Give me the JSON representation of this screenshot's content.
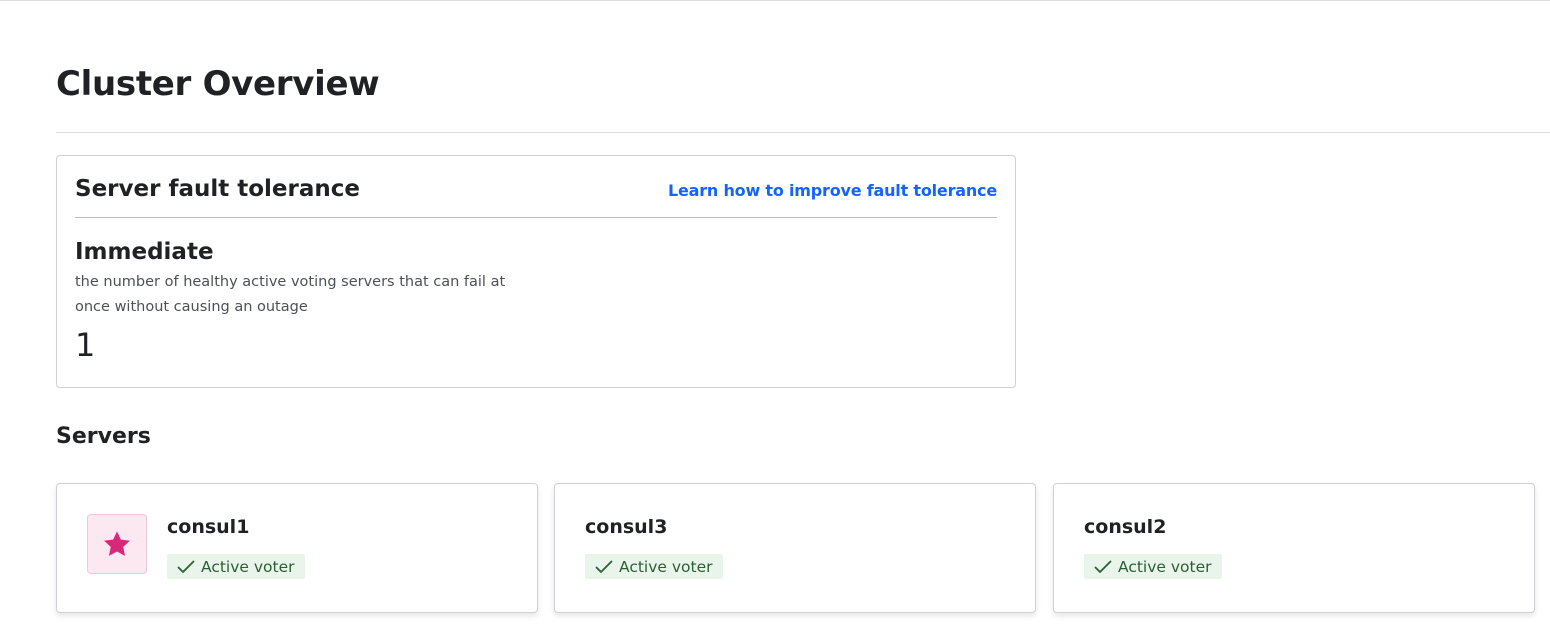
{
  "page": {
    "title": "Cluster Overview"
  },
  "fault_tolerance": {
    "title": "Server fault tolerance",
    "link_label": "Learn how to improve fault tolerance",
    "metric_title": "Immediate",
    "metric_description": "the number of healthy active voting servers that can fail at once without causing an outage",
    "metric_value": "1"
  },
  "servers": {
    "heading": "Servers",
    "items": [
      {
        "name": "consul1",
        "status": "Active voter",
        "leader": true,
        "icon": "star-icon"
      },
      {
        "name": "consul3",
        "status": "Active voter",
        "leader": false
      },
      {
        "name": "consul2",
        "status": "Active voter",
        "leader": false
      }
    ]
  },
  "colors": {
    "link": "#1563ff",
    "leader_star": "#d8287a",
    "leader_bg": "#fce8f1",
    "status_bg": "#e9f5ea",
    "status_text": "#2a5f33"
  }
}
